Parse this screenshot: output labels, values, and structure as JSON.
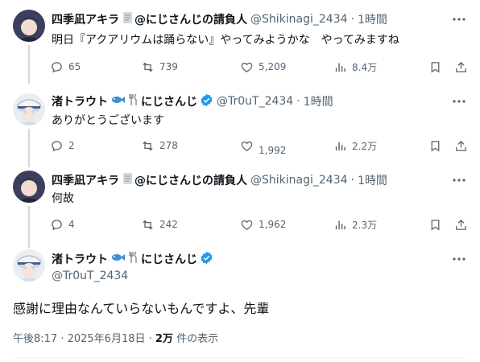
{
  "tweets": [
    {
      "name": "四季凪アキラ",
      "suffix": "@にじさんじの請負人",
      "handle": "@Shikinagi_2434",
      "time": "1時間",
      "text": "明日『アクアリウムは踊らない』やってみようかな　やってみますね",
      "replies": "65",
      "retweets": "739",
      "likes": "5,209",
      "views": "8.4万"
    },
    {
      "name": "渚トラウト",
      "suffix": "にじさんじ",
      "handle": "@Tr0uT_2434",
      "time": "1時間",
      "text": "ありがとうございます",
      "replies": "2",
      "retweets": "278",
      "likes": "1,992",
      "views": "2.2万"
    },
    {
      "name": "四季凪アキラ",
      "suffix": "@にじさんじの請負人",
      "handle": "@Shikinagi_2434",
      "time": "1時間",
      "text": "何故",
      "replies": "4",
      "retweets": "242",
      "likes": "1,962",
      "views": "2.3万"
    }
  ],
  "main": {
    "name": "渚トラウト",
    "suffix": "にじさんじ",
    "handle": "@Tr0uT_2434",
    "text": "感謝に理由なんていらないもんですよ、先輩",
    "timestamp": "午後8:17 · 2025年6月18日 · ",
    "views_count": "2万",
    "views_label": " 件の表示"
  },
  "colors": {
    "text": "#0f1419",
    "secondary": "#536471",
    "verified": "#1d9bf0",
    "line": "#cfd9de"
  }
}
